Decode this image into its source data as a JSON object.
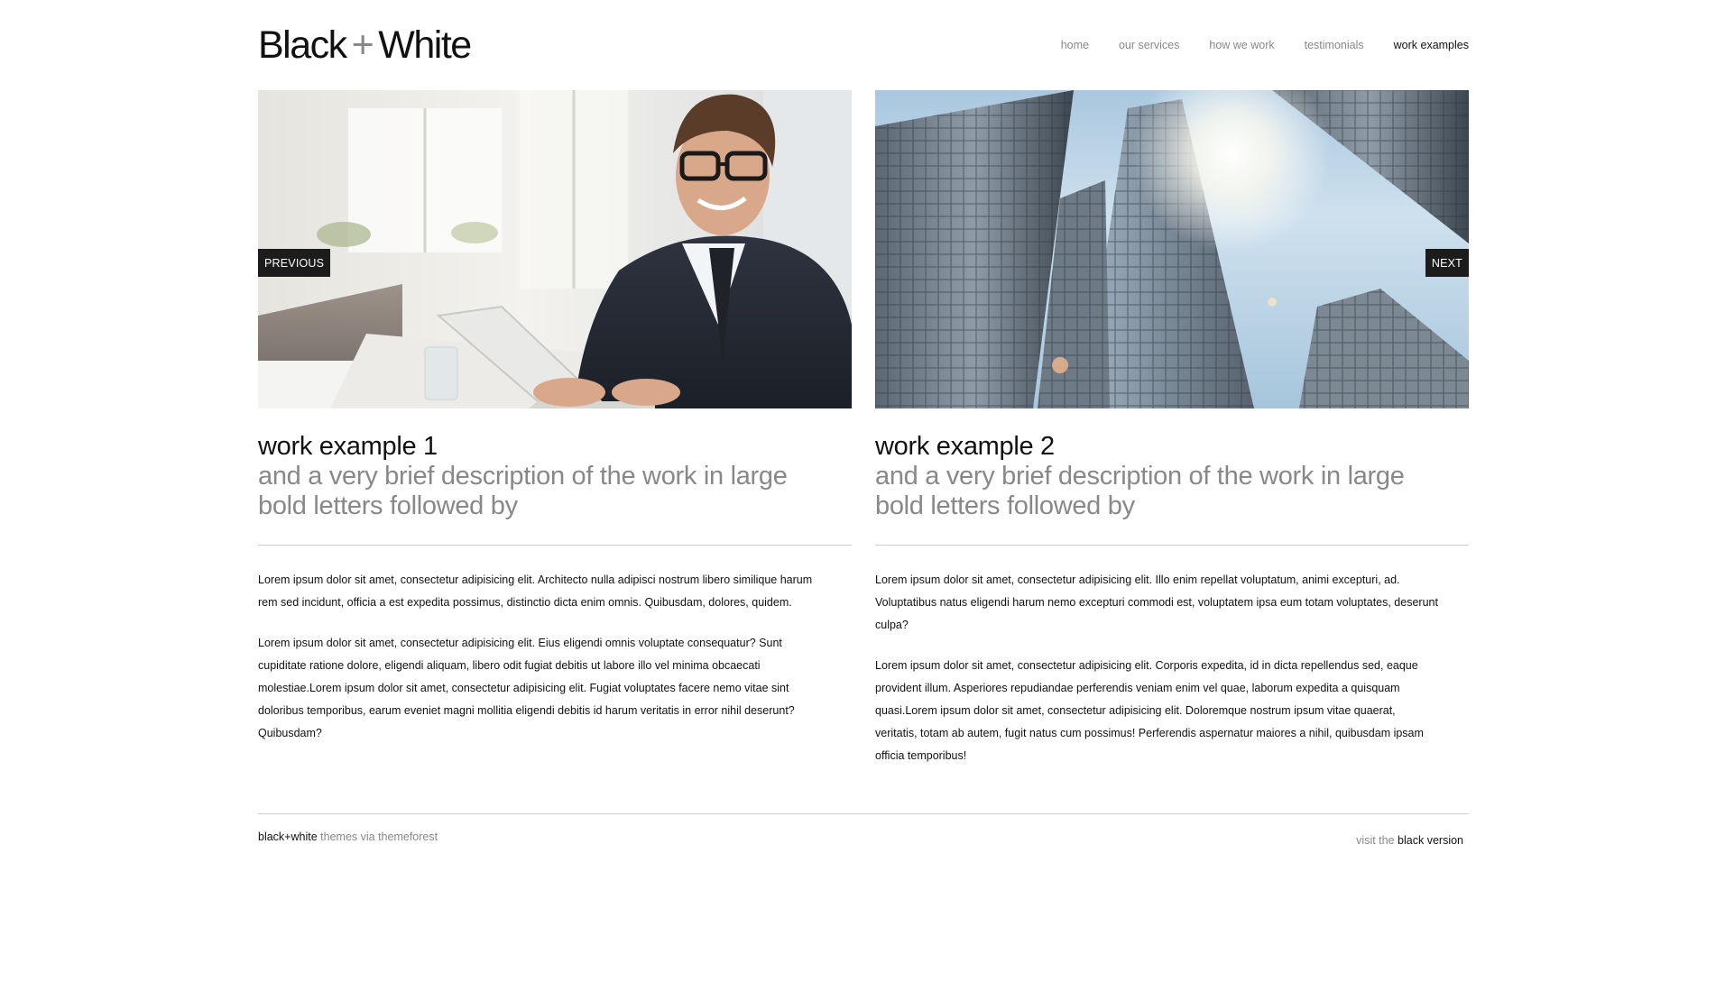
{
  "header": {
    "logo_part1": "Black",
    "logo_plus": "+",
    "logo_part2": "White",
    "nav": [
      {
        "label": "home",
        "active": false
      },
      {
        "label": "our services",
        "active": false
      },
      {
        "label": "how we work",
        "active": false
      },
      {
        "label": "testimonials",
        "active": false
      },
      {
        "label": "work examples",
        "active": true
      }
    ]
  },
  "slider": {
    "prev_label": "PREVIOUS",
    "next_label": "NEXT"
  },
  "examples": [
    {
      "title": "work example 1",
      "subtitle": "and a very brief description of the work in large bold letters followed by",
      "paragraphs": [
        "Lorem ipsum dolor sit amet, consectetur adipisicing elit. Architecto nulla adipisci nostrum libero similique harum rem sed incidunt, officia a est expedita possimus, distinctio dicta enim omnis. Quibusdam, dolores, quidem.",
        "Lorem ipsum dolor sit amet, consectetur adipisicing elit. Eius eligendi omnis voluptate consequatur? Sunt cupiditate ratione dolore, eligendi aliquam, libero odit fugiat debitis ut labore illo vel minima obcaecati molestiae.Lorem ipsum dolor sit amet, consectetur adipisicing elit. Fugiat voluptates facere nemo vitae sint doloribus temporibus, earum eveniet magni mollitia eligendi debitis id harum veritatis in error nihil deserunt? Quibusdam?"
      ]
    },
    {
      "title": "work example 2",
      "subtitle": "and a very brief description of the work in large bold letters followed by",
      "paragraphs": [
        "Lorem ipsum dolor sit amet, consectetur adipisicing elit. Illo enim repellat voluptatum, animi excepturi, ad. Voluptatibus natus eligendi harum nemo excepturi commodi est, voluptatem ipsa eum totam voluptates, deserunt culpa?",
        "Lorem ipsum dolor sit amet, consectetur adipisicing elit. Corporis expedita, id in dicta repellendus sed, eaque provident illum. Asperiores repudiandae perferendis veniam enim vel quae, laborum expedita a quisquam quasi.Lorem ipsum dolor sit amet, consectetur adipisicing elit. Doloremque nostrum ipsum vitae quaerat, veritatis, totam ab autem, fugit natus cum possimus! Perferendis aspernatur maiores a nihil, quibusdam ipsam officia temporibus!"
      ]
    }
  ],
  "footer": {
    "brand": "black+white",
    "brand_suffix": "themes via themeforest",
    "visit_prefix": "visit the",
    "visit_link": "black version"
  },
  "colors": {
    "text": "#111111",
    "muted": "#888888",
    "divider": "#cccccc",
    "button_bg": "#1c1c1c"
  }
}
